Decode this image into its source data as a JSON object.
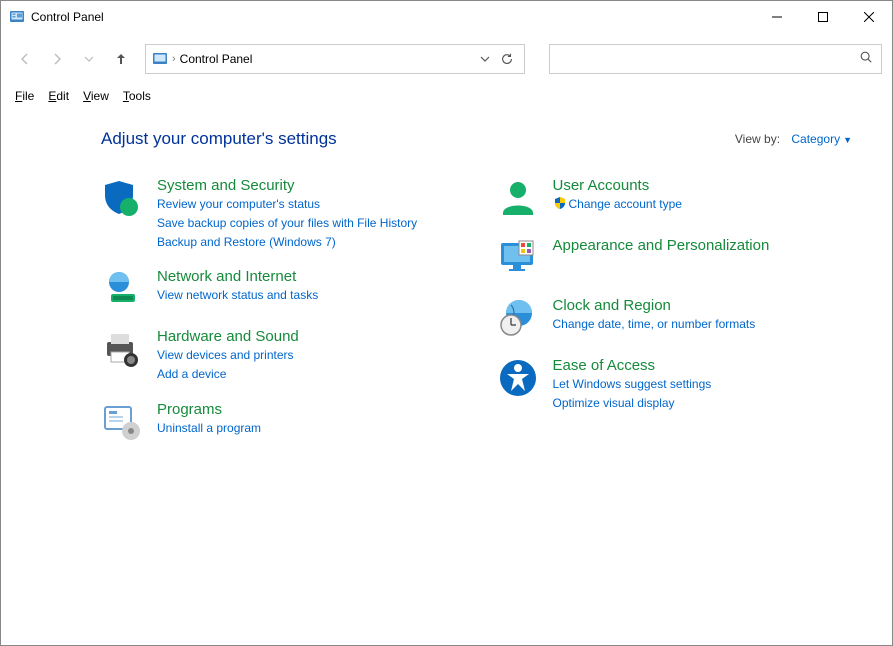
{
  "window": {
    "title": "Control Panel"
  },
  "menubar": {
    "file": "File",
    "edit": "Edit",
    "view": "View",
    "tools": "Tools"
  },
  "address": {
    "crumb": "Control Panel"
  },
  "heading": "Adjust your computer's settings",
  "viewby": {
    "label": "View by:",
    "value": "Category"
  },
  "categories": {
    "system_security": {
      "title": "System and Security",
      "links": [
        "Review your computer's status",
        "Save backup copies of your files with File History",
        "Backup and Restore (Windows 7)"
      ]
    },
    "network": {
      "title": "Network and Internet",
      "links": [
        "View network status and tasks"
      ]
    },
    "hardware": {
      "title": "Hardware and Sound",
      "links": [
        "View devices and printers",
        "Add a device"
      ]
    },
    "programs": {
      "title": "Programs",
      "links": [
        "Uninstall a program"
      ]
    },
    "user_accounts": {
      "title": "User Accounts",
      "links": [
        "Change account type"
      ]
    },
    "appearance": {
      "title": "Appearance and Personalization",
      "links": []
    },
    "clock": {
      "title": "Clock and Region",
      "links": [
        "Change date, time, or number formats"
      ]
    },
    "ease": {
      "title": "Ease of Access",
      "links": [
        "Let Windows suggest settings",
        "Optimize visual display"
      ]
    }
  }
}
